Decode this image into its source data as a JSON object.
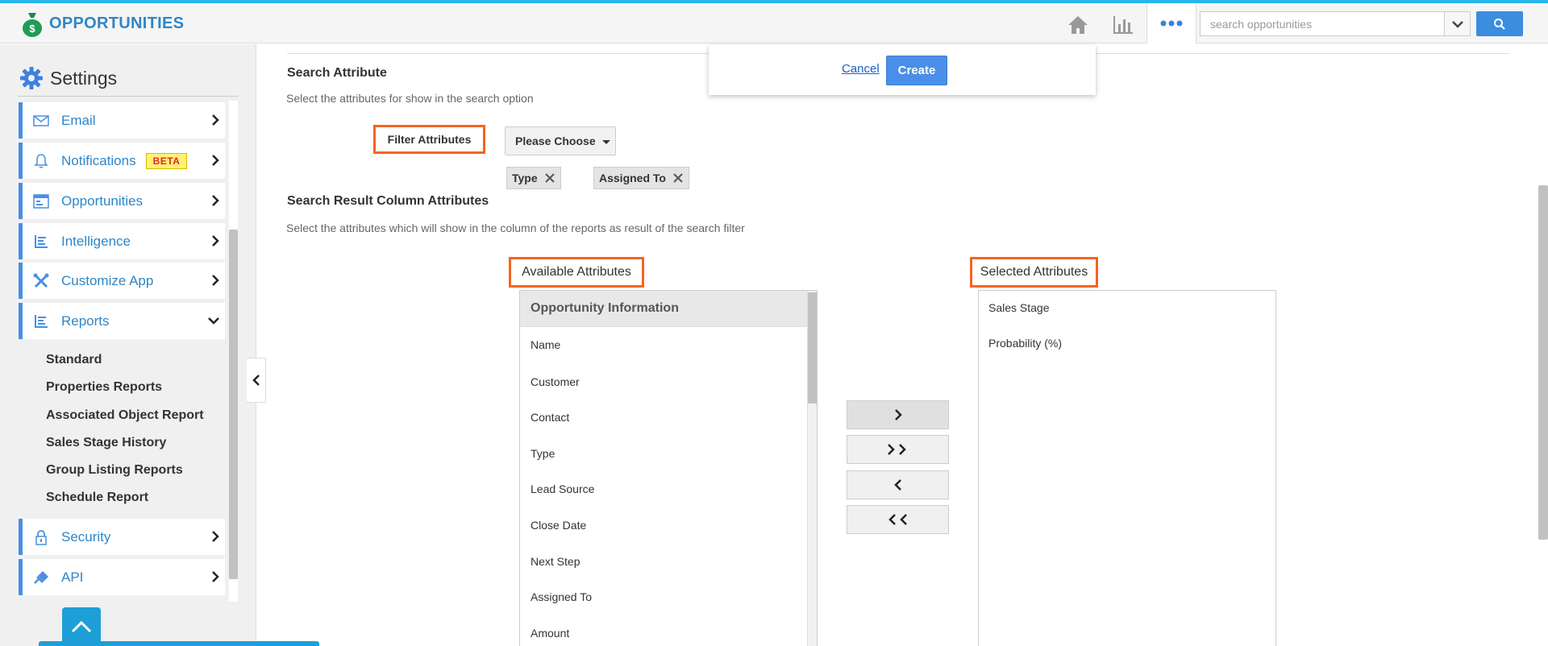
{
  "app": {
    "title": "OPPORTUNITIES"
  },
  "header": {
    "search_placeholder": "search opportunities",
    "icons": [
      "home-icon",
      "bar-chart-icon",
      "more-dots-icon",
      "chevron-down-icon",
      "search-icon"
    ]
  },
  "sidebar": {
    "title": "Settings",
    "items": [
      {
        "label": "Email",
        "icon": "envelope-icon"
      },
      {
        "label": "Notifications",
        "icon": "bell-icon",
        "badge": "BETA"
      },
      {
        "label": "Opportunities",
        "icon": "opportunities-icon"
      },
      {
        "label": "Intelligence",
        "icon": "intelligence-icon"
      },
      {
        "label": "Customize App",
        "icon": "tools-icon"
      },
      {
        "label": "Reports",
        "icon": "reports-icon",
        "expanded": true
      },
      {
        "label": "Security",
        "icon": "lock-icon"
      },
      {
        "label": "API",
        "icon": "plug-icon"
      }
    ],
    "reports_sub": [
      "Standard",
      "Properties Reports",
      "Associated Object Report",
      "Sales Stage History",
      "Group Listing Reports",
      "Schedule Report"
    ]
  },
  "popup": {
    "cancel": "Cancel",
    "create": "Create"
  },
  "search_attribute": {
    "title": "Search Attribute",
    "subtitle": "Select the attributes for show in the search option",
    "filter_label": "Filter Attributes",
    "dropdown_value": "Please Choose",
    "tags": [
      "Type",
      "Assigned To"
    ]
  },
  "result_columns": {
    "title": "Search Result Column Attributes",
    "subtitle": "Select the attributes which will show in the column of the reports as result of the search filter",
    "available_label": "Available Attributes",
    "selected_label": "Selected Attributes",
    "available_group": "Opportunity Information",
    "available_items": [
      "Name",
      "Customer",
      "Contact",
      "Type",
      "Lead Source",
      "Close Date",
      "Next Step",
      "Assigned To",
      "Amount"
    ],
    "selected_items": [
      "Sales Stage",
      "Probability (%)"
    ]
  },
  "colors": {
    "accent": "#4a8fe0",
    "highlight": "#f26522",
    "topline": "#29b6e8",
    "brand_text": "#2f86c8"
  }
}
